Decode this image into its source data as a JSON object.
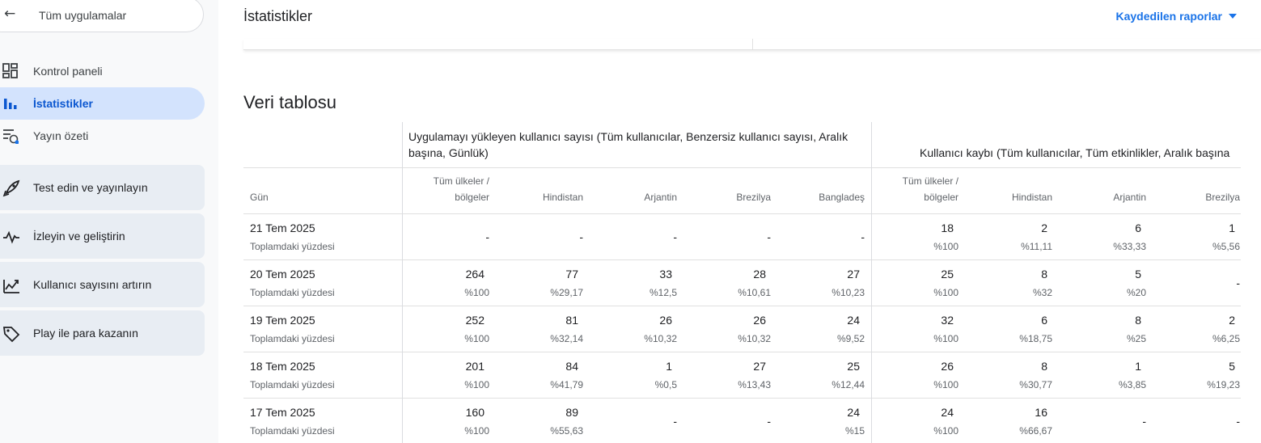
{
  "sidebar": {
    "back_label": "Tüm uygulamalar",
    "items": [
      {
        "label": "Kontrol paneli",
        "icon": "dashboard-icon",
        "active": false
      },
      {
        "label": "İstatistikler",
        "icon": "bar-chart-icon",
        "active": true
      },
      {
        "label": "Yayın özeti",
        "icon": "publishing-overview-icon",
        "active": false
      }
    ],
    "cards": [
      {
        "label": "Test edin ve yayınlayın",
        "icon": "rocket-icon"
      },
      {
        "label": "İzleyin ve geliştirin",
        "icon": "pulse-icon"
      },
      {
        "label": "Kullanıcı sayısını artırın",
        "icon": "growth-chart-icon"
      },
      {
        "label": "Play ile para kazanın",
        "icon": "tag-icon"
      }
    ]
  },
  "header": {
    "title": "İstatistikler",
    "saved_reports": "Kaydedilen raporlar"
  },
  "section": {
    "title": "Veri tablosu"
  },
  "table": {
    "group1": "Uygulamayı yükleyen kullanıcı sayısı (Tüm kullanıcılar, Benzersiz kullanıcı sayısı, Aralık başına, Günlük)",
    "group2": "Kullanıcı kaybı (Tüm kullanıcılar, Tüm etkinlikler, Aralık başına",
    "date_header": "Gün",
    "columns1": [
      "Tüm ülkeler / bölgeler",
      "Hindistan",
      "Arjantin",
      "Brezilya",
      "Bangladeş"
    ],
    "columns2": [
      "Tüm ülkeler / bölgeler",
      "Hindistan",
      "Arjantin",
      "Brezilya"
    ],
    "pct_label": "Toplamdaki yüzdesi",
    "rows": [
      {
        "date": "21 Tem 2025",
        "g1": [
          null,
          null,
          null,
          null,
          null
        ],
        "g2": [
          [
            "18",
            "%100"
          ],
          [
            "2",
            "%11,11"
          ],
          [
            "6",
            "%33,33"
          ],
          [
            "1",
            "%5,56"
          ]
        ]
      },
      {
        "date": "20 Tem 2025",
        "g1": [
          [
            "264",
            "%100"
          ],
          [
            "77",
            "%29,17"
          ],
          [
            "33",
            "%12,5"
          ],
          [
            "28",
            "%10,61"
          ],
          [
            "27",
            "%10,23"
          ]
        ],
        "g2": [
          [
            "25",
            "%100"
          ],
          [
            "8",
            "%32"
          ],
          [
            "5",
            "%20"
          ],
          null
        ]
      },
      {
        "date": "19 Tem 2025",
        "g1": [
          [
            "252",
            "%100"
          ],
          [
            "81",
            "%32,14"
          ],
          [
            "26",
            "%10,32"
          ],
          [
            "26",
            "%10,32"
          ],
          [
            "24",
            "%9,52"
          ]
        ],
        "g2": [
          [
            "32",
            "%100"
          ],
          [
            "6",
            "%18,75"
          ],
          [
            "8",
            "%25"
          ],
          [
            "2",
            "%6,25"
          ]
        ]
      },
      {
        "date": "18 Tem 2025",
        "g1": [
          [
            "201",
            "%100"
          ],
          [
            "84",
            "%41,79"
          ],
          [
            "1",
            "%0,5"
          ],
          [
            "27",
            "%13,43"
          ],
          [
            "25",
            "%12,44"
          ]
        ],
        "g2": [
          [
            "26",
            "%100"
          ],
          [
            "8",
            "%30,77"
          ],
          [
            "1",
            "%3,85"
          ],
          [
            "5",
            "%19,23"
          ]
        ]
      },
      {
        "date": "17 Tem 2025",
        "g1": [
          [
            "160",
            "%100"
          ],
          [
            "89",
            "%55,63"
          ],
          null,
          null,
          [
            "24",
            "%15"
          ]
        ],
        "g2": [
          [
            "24",
            "%100"
          ],
          [
            "16",
            "%66,67"
          ],
          null,
          null
        ]
      }
    ]
  }
}
